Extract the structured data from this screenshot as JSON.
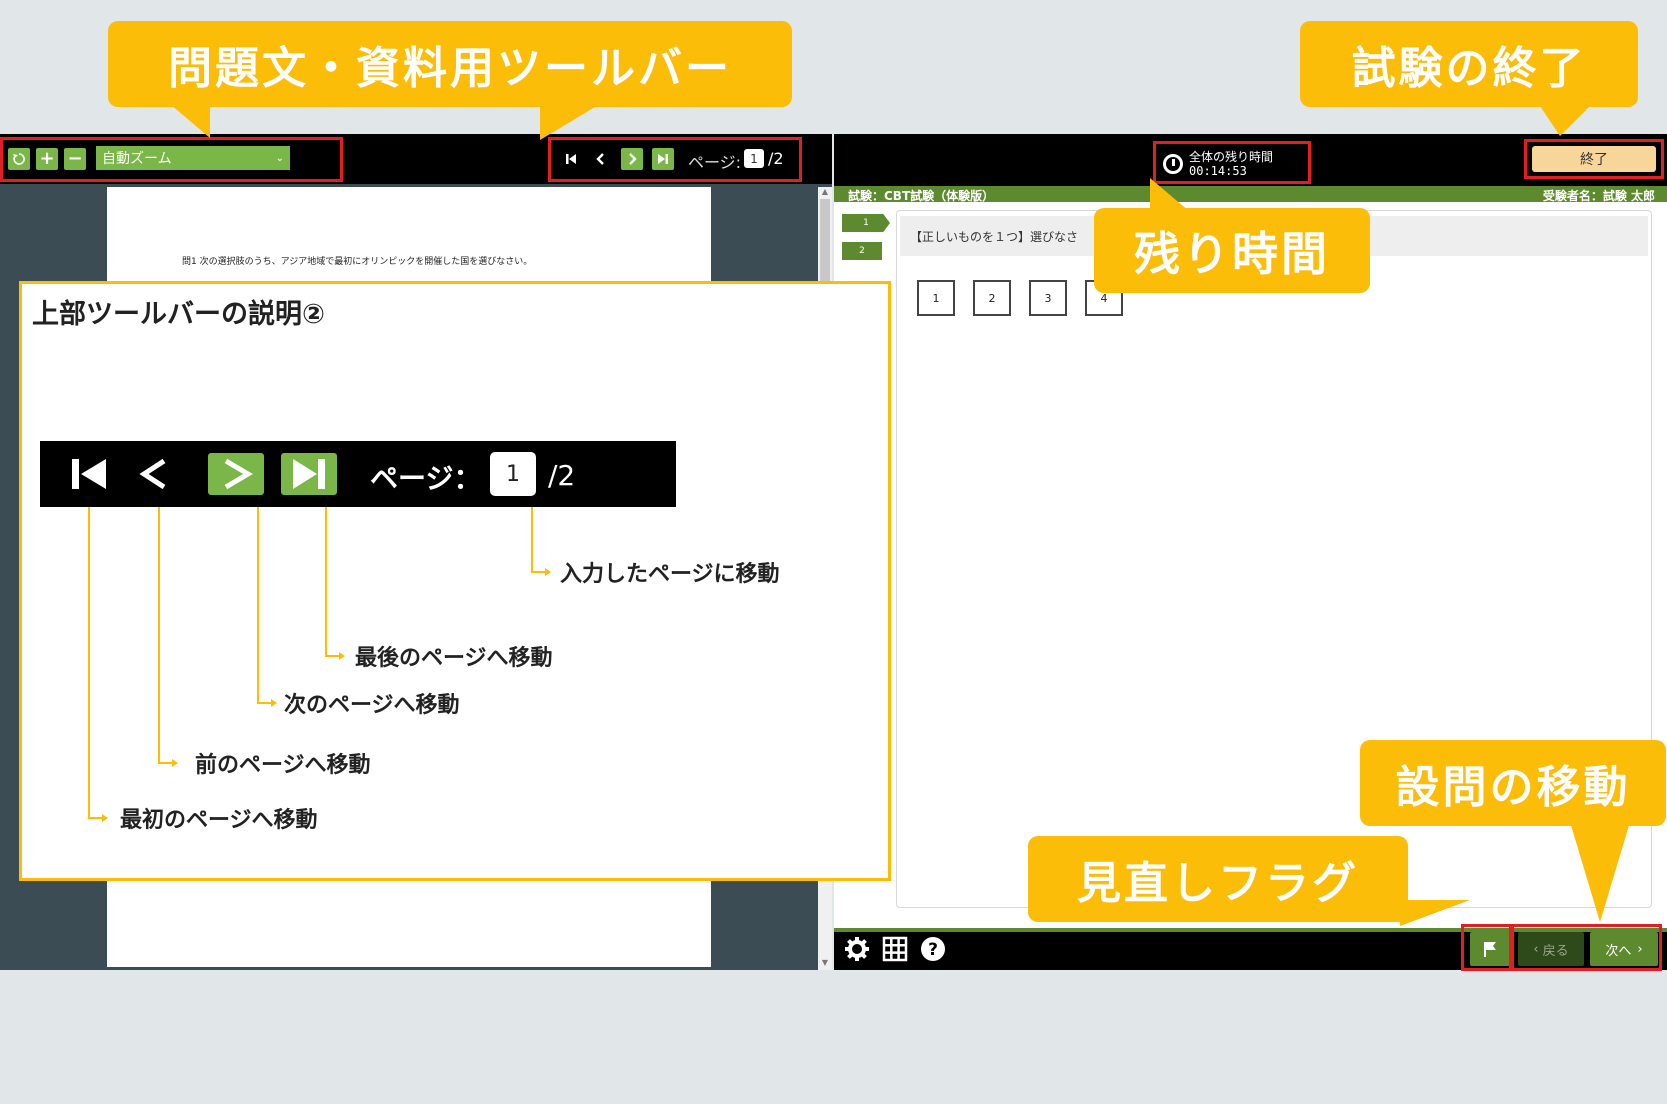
{
  "left_toolbar": {
    "zoom": "自動ズーム",
    "page_label": "ページ:",
    "page_value": "1",
    "page_total": "/2"
  },
  "document": {
    "question": "問1 次の選択肢のうち、アジア地域で最初にオリンピックを開催した国を選びなさい。"
  },
  "right_header": {
    "timer_label": "全体の残り時間",
    "timer_value": "00:14:53",
    "end_button": "終了"
  },
  "exam_bar": {
    "exam_name": "試験：CBT試験（体験版）",
    "examinee": "受験者名：試験 太郎"
  },
  "question_tabs": [
    "1",
    "2"
  ],
  "question": {
    "instruction": "【正しいものを１つ】選びなさ",
    "choices": [
      "1",
      "2",
      "3",
      "4"
    ]
  },
  "footer": {
    "back": "戻る",
    "next": "次へ"
  },
  "callouts": {
    "toolbar": "問題文・資料用ツールバー",
    "end": "試験の終了",
    "time": "残り時間",
    "move": "設問の移動",
    "flag": "見直しフラグ"
  },
  "explain": {
    "title": "上部ツールバーの説明②",
    "page_label": "ページ：",
    "page_value": "1",
    "page_total": "/2",
    "items": {
      "input_page": "入力したページに移動",
      "last_page": "最後のページへ移動",
      "next_page": "次のページへ移動",
      "prev_page": "前のページへ移動",
      "first_page": "最初のページへ移動"
    }
  },
  "colors": {
    "callout": "#fbbd08",
    "green": "#7ab648",
    "dark_green": "#5d8a2e",
    "highlight_red": "#e01e24"
  }
}
